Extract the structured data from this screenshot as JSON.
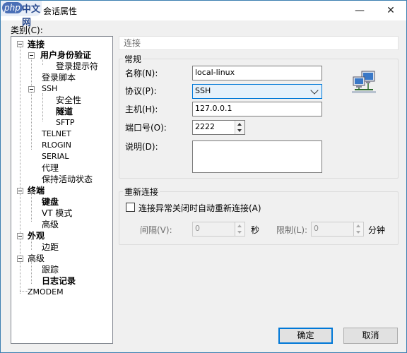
{
  "window": {
    "watermark_php": "php",
    "watermark_cn": "中文网",
    "title": "会话属性",
    "minimize": "—",
    "close": "✕"
  },
  "category_label": "类别(C):",
  "tree": {
    "connection": "连接",
    "auth": "用户身份验证",
    "login_prompt": "登录提示符",
    "login_script": "登录脚本",
    "ssh": "SSH",
    "security": "安全性",
    "tunnel": "隧道",
    "sftp": "SFTP",
    "telnet": "TELNET",
    "rlogin": "RLOGIN",
    "serial": "SERIAL",
    "proxy": "代理",
    "keepalive": "保持活动状态",
    "terminal": "终端",
    "keyboard": "键盘",
    "vt_mode": "VT 模式",
    "advanced1": "高级",
    "appearance": "外观",
    "margin": "边距",
    "advanced2": "高级",
    "trace": "跟踪",
    "logging": "日志记录",
    "zmodem": "ZMODEM"
  },
  "panel": {
    "header": "连接",
    "general_group": "常规",
    "name_label": "名称(N):",
    "name_value": "local-linux",
    "protocol_label": "协议(P):",
    "protocol_value": "SSH",
    "host_label": "主机(H):",
    "host_value": "127.0.0.1",
    "port_label": "端口号(O):",
    "port_value": "2222",
    "desc_label": "说明(D):",
    "desc_value": "",
    "reconnect_group": "重新连接",
    "reconnect_checkbox": "连接异常关闭时自动重新连接(A)",
    "interval_label": "间隔(V):",
    "interval_value": "0",
    "seconds": "秒",
    "limit_label": "限制(L):",
    "limit_value": "0",
    "minutes": "分钟"
  },
  "buttons": {
    "ok": "确定",
    "cancel": "取消"
  },
  "colors": {
    "accent": "#0078d7",
    "select_bg": "#e5f1fb"
  }
}
